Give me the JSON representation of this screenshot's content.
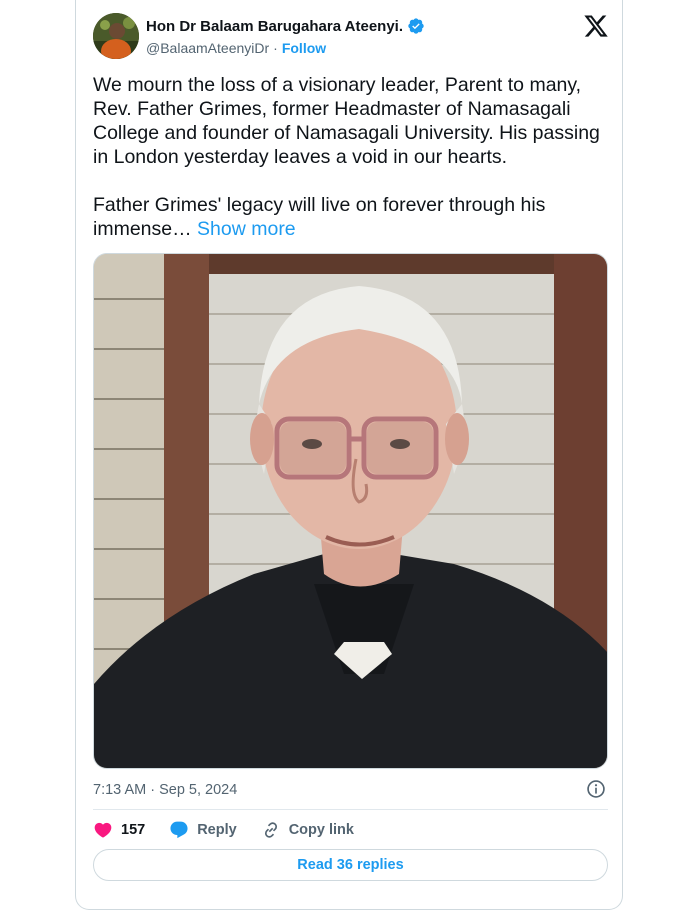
{
  "author": {
    "name": "Hon Dr Balaam Barugahara Ateenyi.",
    "handle": "@BalaamAteenyiDr",
    "follow_label": "Follow",
    "verified": true
  },
  "tweet": {
    "text": "We mourn the loss of a visionary leader, Parent to many, Rev. Father Grimes, former Headmaster of Namasagali College and founder of Namasagali University. His passing in London yesterday leaves a void in our hearts.\n\nFather Grimes' legacy will live on forever through his immense…",
    "show_more_label": "Show more"
  },
  "meta": {
    "timestamp": "7:13 AM · Sep 5, 2024"
  },
  "actions": {
    "likes": "157",
    "reply_label": "Reply",
    "copy_link_label": "Copy link"
  },
  "read_replies_label": "Read 36 replies",
  "colors": {
    "accent": "#1d9bf0",
    "like": "#f91880",
    "text": "#0f1419",
    "muted": "#536471",
    "border": "#cfd9de"
  },
  "icons": [
    "verified-badge-icon",
    "x-logo-icon",
    "info-icon",
    "heart-icon",
    "reply-icon",
    "link-icon"
  ]
}
